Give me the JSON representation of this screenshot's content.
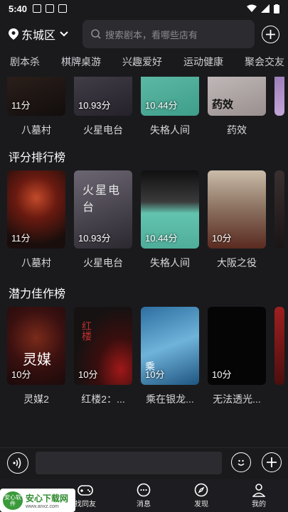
{
  "status": {
    "time": "5:40"
  },
  "location": {
    "city": "东城区"
  },
  "search": {
    "placeholder": "搜索剧本，看哪些店有"
  },
  "tabs": [
    "剧本杀",
    "棋牌桌游",
    "兴趣爱好",
    "运动健康",
    "聚会交友"
  ],
  "row1": [
    {
      "title": "八墓村",
      "score": "11分",
      "color": "#2a1a1a"
    },
    {
      "title": "火星电台",
      "score": "10.93分",
      "color": "#3b3742"
    },
    {
      "title": "失格人间",
      "score": "10.44分",
      "color": "#5cbca8"
    },
    {
      "title": "药效",
      "score": "",
      "color": "#c7c0c0",
      "poster_text": "药效"
    }
  ],
  "sections": [
    {
      "title": "评分排行榜",
      "items": [
        {
          "title": "八墓村",
          "score": "11分",
          "color": "#3a1515",
          "poster_text": ""
        },
        {
          "title": "火星电台",
          "score": "10.93分",
          "color": "#4a4452",
          "poster_text": "火星电台"
        },
        {
          "title": "失格人间",
          "score": "10.44分",
          "color": "#57b9a6",
          "poster_text": ""
        },
        {
          "title": "大阪之役",
          "score": "10分",
          "color": "#8a6f5e",
          "poster_text": ""
        }
      ]
    },
    {
      "title": "潜力佳作榜",
      "items": [
        {
          "title": "灵媒2",
          "score": "10分",
          "color": "#3a1010",
          "poster_text": "灵媒"
        },
        {
          "title": "红楼2：...",
          "score": "10分",
          "color": "#1c1414",
          "poster_text": "红楼"
        },
        {
          "title": "乘在银龙...",
          "score": "10分",
          "color": "#3f86b4",
          "poster_text": "乘"
        },
        {
          "title": "无法透光...",
          "score": "10分",
          "color": "#050505",
          "poster_text": ""
        }
      ]
    }
  ],
  "nav": [
    {
      "label": "找同友",
      "icon": "gamepad-icon"
    },
    {
      "label": "消息",
      "icon": "chat-icon"
    },
    {
      "label": "发现",
      "icon": "compass-icon"
    },
    {
      "label": "我的",
      "icon": "user-icon"
    }
  ],
  "watermark": {
    "logo": "安心软件",
    "name": "安心下载网",
    "url": "www.anxz.com"
  }
}
